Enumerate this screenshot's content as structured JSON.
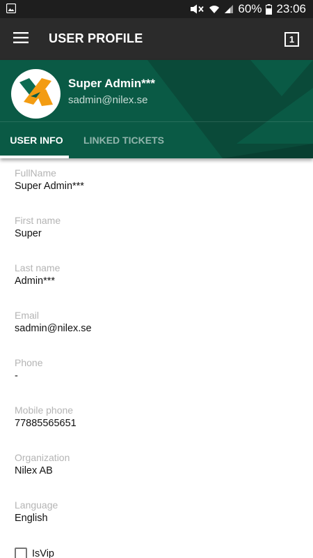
{
  "status_bar": {
    "battery": "60%",
    "time": "23:06"
  },
  "app_bar": {
    "title": "USER PROFILE",
    "tab_count": "1"
  },
  "profile": {
    "name": "Super Admin***",
    "email": "sadmin@nilex.se"
  },
  "tabs": [
    {
      "label": "USER INFO",
      "selected": true
    },
    {
      "label": "LINKED TICKETS",
      "selected": false
    }
  ],
  "fields": [
    {
      "label": "FullName",
      "value": "Super Admin***"
    },
    {
      "label": "First name",
      "value": "Super"
    },
    {
      "label": "Last name",
      "value": "Admin***"
    },
    {
      "label": "Email",
      "value": "sadmin@nilex.se"
    },
    {
      "label": "Phone",
      "value": "-"
    },
    {
      "label": "Mobile phone",
      "value": "77885565651"
    },
    {
      "label": "Organization",
      "value": "Nilex AB"
    },
    {
      "label": "Language",
      "value": "English"
    }
  ],
  "is_vip": {
    "label": "IsVip",
    "checked": false
  },
  "colors": {
    "header_green": "#0a5a45",
    "app_bar": "#2b2b2b",
    "logo_green": "#0d6b52",
    "logo_orange": "#f39c12"
  },
  "icons": {
    "menu": "hamburger-menu-icon",
    "tabs": "tab-switcher-icon",
    "gallery": "gallery-notification-icon",
    "mute": "mute-icon",
    "wifi": "wifi-icon",
    "signal": "signal-icon",
    "battery": "battery-icon"
  }
}
